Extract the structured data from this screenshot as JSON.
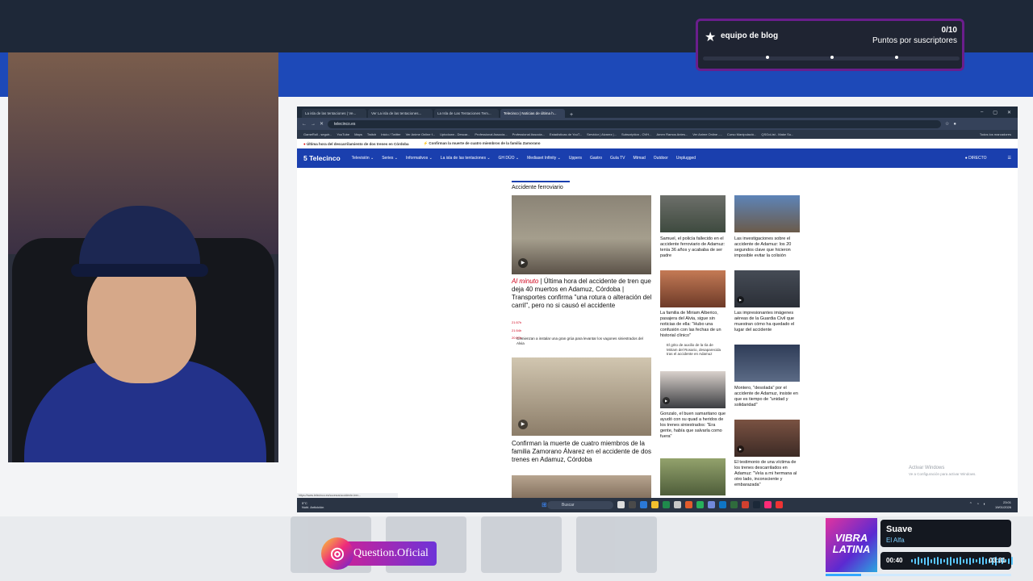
{
  "widget": {
    "title": "equipo de blog",
    "count": "0/10",
    "subtitle": "Puntos por suscriptores",
    "progress": 0
  },
  "browser": {
    "tabs": [
      {
        "label": "La isla de las tentaciones | Ve..."
      },
      {
        "label": "Ver La isla de las tentaciones..."
      },
      {
        "label": "La Isla de Las Tentaciones Tem..."
      },
      {
        "label": "Telecinco | Noticias de última h..."
      }
    ],
    "url": "telecinco.es",
    "bookmarks": [
      "GameRoll - seguir...",
      "YouTube",
      "Maps",
      "Twitch",
      "Inicio / Twitter",
      "Ver Anime Online f...",
      "Uptodown - Descar...",
      "Professional Associa...",
      "Professional Associa...",
      "Estadísticas de YouT...",
      "Servidor | Alvarez |...",
      "Subscription - OVH...",
      "Amen Ramos Antes...",
      "Ver Anime Online -...",
      "Curso Manipulació...",
      "QSGoList - Make Su...",
      "Todos los marcadores"
    ],
    "ticker": [
      {
        "label": "Última hora del descarrilamiento de dos trenes en Córdoba"
      },
      {
        "label": "Confirman la muerte de cuatro miembros de la familia Zamorano"
      }
    ],
    "site": {
      "logo": "5 Telecinco",
      "nav": [
        "Televisión ⌄",
        "Series ⌄",
        "Informativos ⌄",
        "La isla de las tentaciones ⌄",
        "GH DÚO ⌄",
        "Mediaset Infinity ⌄",
        "Uppers",
        "Gastro",
        "Guía TV",
        "Mtmad",
        "Outdoor",
        "Unplugged"
      ],
      "directo": "● DIRECTO",
      "menu": "☰",
      "section": "Accidente ferroviario",
      "main": {
        "tag": "Al minuto",
        "headline": "| Última hora del accidente de tren que deja 40 muertos en Adamuz, Córdoba | Transportes confirma \"una rotura o alteración del carril\", pero no si causó el accidente",
        "times": [
          "21:57h",
          "21:54h",
          "20:57h"
        ],
        "sub": "Comienzan a instalar una gran grúa para levantar los vagones siniestrados del Alvia"
      },
      "second_headline": "Confirman la muerte de cuatro miembros de la familia Zamorano Álvarez en el accidente de dos trenes en Adamuz, Córdoba",
      "cards_col1": [
        "Samuel, el policía fallecido en el accidente ferroviario de Adamuz: tenía 36 años y acababa de ser padre",
        "La familia de Miriam Alberico, pasajera del Alvia, sigue sin noticias de ella: \"Hubo una confusión con las fechas de un historial clínico\"",
        "Gonzalo, el buen samaritano que ayudó con su quad a heridos de los trenes siniestrados: \"Era gente, había que salvarla como fuera\""
      ],
      "col1_sub": "El grito de auxilio de la tía de Miriam del Rosario, desaparecida tras el accidente en Adamuz",
      "cards_col2": [
        "Las investigaciones sobre el accidente de Adamuz: los 20 segundos clave que hicieron imposible evitar la colisión",
        "Las impresionantes imágenes aéreas de la Guardia Civil que muestran cómo ha quedado el lugar del accidente",
        "Montero, \"desolada\" por el accidente de Adamuz, insiste en que es tiempo de \"unidad y solidaridad\"",
        "El testimonio de una víctima de los trenes descarrilados en Adamuz: \"Veía a mi hermana al otro lado, inconsciente y embarazada\""
      ]
    },
    "watermark": [
      "Activar Windows",
      "Ve a Configuración para activar Windows."
    ],
    "status_url": "https://www.telecinco.es/sucesos/accidente-tren...",
    "taskbar": {
      "weather_temp": "5°C",
      "weather_desc": "Nubl. Anticiclón",
      "search": "Buscar",
      "time": "23:01",
      "date": "19/01/2026"
    }
  },
  "instagram": {
    "handle": "Question.Oficial"
  },
  "music": {
    "album_text": "VIBRA LATINA",
    "title": "Suave",
    "artist": "El Alfa",
    "current": "00:40",
    "duration": "03:31",
    "progress": 0.19
  }
}
